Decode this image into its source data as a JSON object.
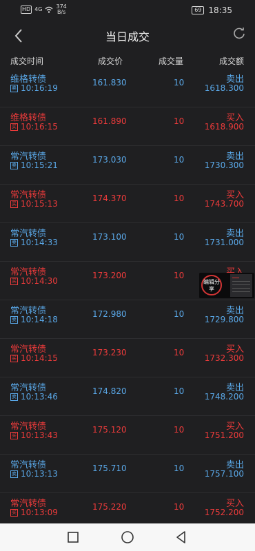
{
  "status_bar": {
    "hd": "HD",
    "signal": "4G",
    "speed_value": "374",
    "speed_unit": "B/s",
    "battery": "69",
    "time": "18:35"
  },
  "header": {
    "title": "当日成交"
  },
  "columns": {
    "time": "成交时间",
    "price": "成交价",
    "volume": "成交量",
    "amount": "成交额"
  },
  "trades": [
    {
      "name": "维格转债",
      "badge": "卖",
      "time": "10:16:19",
      "price": "161.830",
      "volume": "10",
      "side": "卖出",
      "amount": "1618.300",
      "color": "blue"
    },
    {
      "name": "维格转债",
      "badge": "买",
      "time": "10:16:15",
      "price": "161.890",
      "volume": "10",
      "side": "买入",
      "amount": "1618.900",
      "color": "red"
    },
    {
      "name": "常汽转债",
      "badge": "卖",
      "time": "10:15:21",
      "price": "173.030",
      "volume": "10",
      "side": "卖出",
      "amount": "1730.300",
      "color": "blue"
    },
    {
      "name": "常汽转债",
      "badge": "买",
      "time": "10:15:13",
      "price": "174.370",
      "volume": "10",
      "side": "买入",
      "amount": "1743.700",
      "color": "red"
    },
    {
      "name": "常汽转债",
      "badge": "卖",
      "time": "10:14:33",
      "price": "173.100",
      "volume": "10",
      "side": "卖出",
      "amount": "1731.000",
      "color": "blue"
    },
    {
      "name": "常汽转债",
      "badge": "买",
      "time": "10:14:30",
      "price": "173.200",
      "volume": "10",
      "side": "买入",
      "amount": "",
      "color": "red"
    },
    {
      "name": "常汽转债",
      "badge": "卖",
      "time": "10:14:18",
      "price": "172.980",
      "volume": "10",
      "side": "卖出",
      "amount": "1729.800",
      "color": "blue"
    },
    {
      "name": "常汽转债",
      "badge": "买",
      "time": "10:14:15",
      "price": "173.230",
      "volume": "10",
      "side": "买入",
      "amount": "1732.300",
      "color": "red"
    },
    {
      "name": "常汽转债",
      "badge": "卖",
      "time": "10:13:46",
      "price": "174.820",
      "volume": "10",
      "side": "卖出",
      "amount": "1748.200",
      "color": "blue"
    },
    {
      "name": "常汽转债",
      "badge": "买",
      "time": "10:13:43",
      "price": "175.120",
      "volume": "10",
      "side": "买入",
      "amount": "1751.200",
      "color": "red"
    },
    {
      "name": "常汽转债",
      "badge": "卖",
      "time": "10:13:13",
      "price": "175.710",
      "volume": "10",
      "side": "卖出",
      "amount": "1757.100",
      "color": "blue"
    },
    {
      "name": "常汽转债",
      "badge": "买",
      "time": "10:13:09",
      "price": "175.220",
      "volume": "10",
      "side": "买入",
      "amount": "1752.200",
      "color": "red"
    }
  ],
  "float_window": {
    "label": "编辑分享"
  },
  "colors": {
    "sell": "#5aa8e8",
    "buy": "#ee3b3b",
    "background": "#1f1f21"
  },
  "icons": {
    "back": "chevron-left-icon",
    "refresh": "refresh-icon",
    "nav_recent": "square-icon",
    "nav_home": "circle-icon",
    "nav_back": "triangle-back-icon"
  }
}
